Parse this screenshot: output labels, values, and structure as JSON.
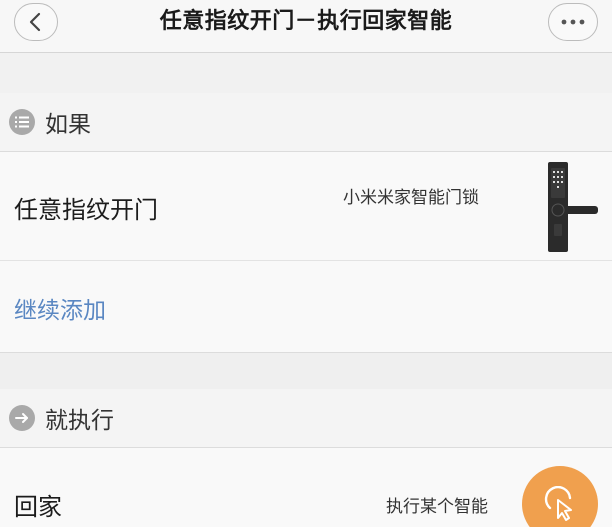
{
  "header": {
    "title": "任意指纹开门－执行回家智能",
    "back_icon": "chevron-left-icon",
    "more_icon": "more-horizontal-icon"
  },
  "if_section": {
    "label": "如果",
    "icon": "list-icon"
  },
  "trigger": {
    "title": "任意指纹开门",
    "device": "小米米家智能门锁",
    "device_icon": "door-lock-icon"
  },
  "add_more": {
    "label": "继续添加"
  },
  "then_section": {
    "label": "就执行",
    "icon": "arrow-right-icon"
  },
  "action": {
    "title": "回家",
    "detail": "执行某个智能",
    "action_icon": "pointer-click-icon"
  },
  "colors": {
    "link": "#5a87c2",
    "accent": "#f0a04e",
    "icon_gray": "#a9a9a9"
  }
}
